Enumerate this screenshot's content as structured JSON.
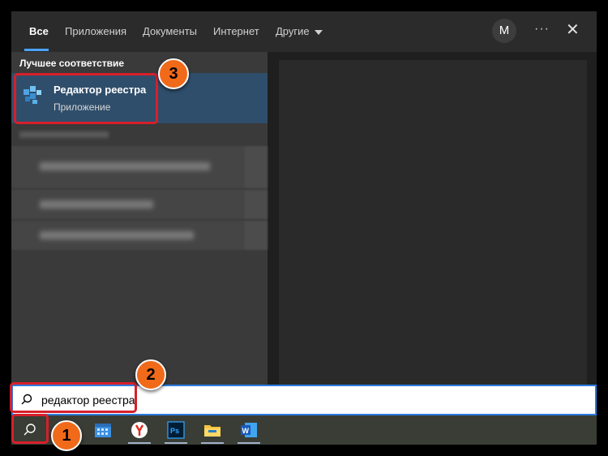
{
  "tabs": {
    "all": "Все",
    "apps": "Приложения",
    "documents": "Документы",
    "internet": "Интернет",
    "other": "Другие"
  },
  "user": {
    "avatar_initial": "M"
  },
  "best_match": {
    "section_title": "Лучшее соответствие",
    "app_name": "Редактор реестра",
    "app_type": "Приложение"
  },
  "search": {
    "query": "редактор реестра"
  },
  "annotations": {
    "step1": "1",
    "step2": "2",
    "step3": "3"
  },
  "colors": {
    "accent": "#2b7de0",
    "highlight": "#d81f2b",
    "badge": "#f06a1a",
    "selection": "#2f4e6b"
  },
  "icons": {
    "more": "more-icon",
    "close": "close-icon",
    "search": "search-icon",
    "taskbar": [
      "calendar-icon",
      "yandex-browser-icon",
      "photoshop-icon",
      "file-explorer-icon",
      "word-icon"
    ]
  }
}
